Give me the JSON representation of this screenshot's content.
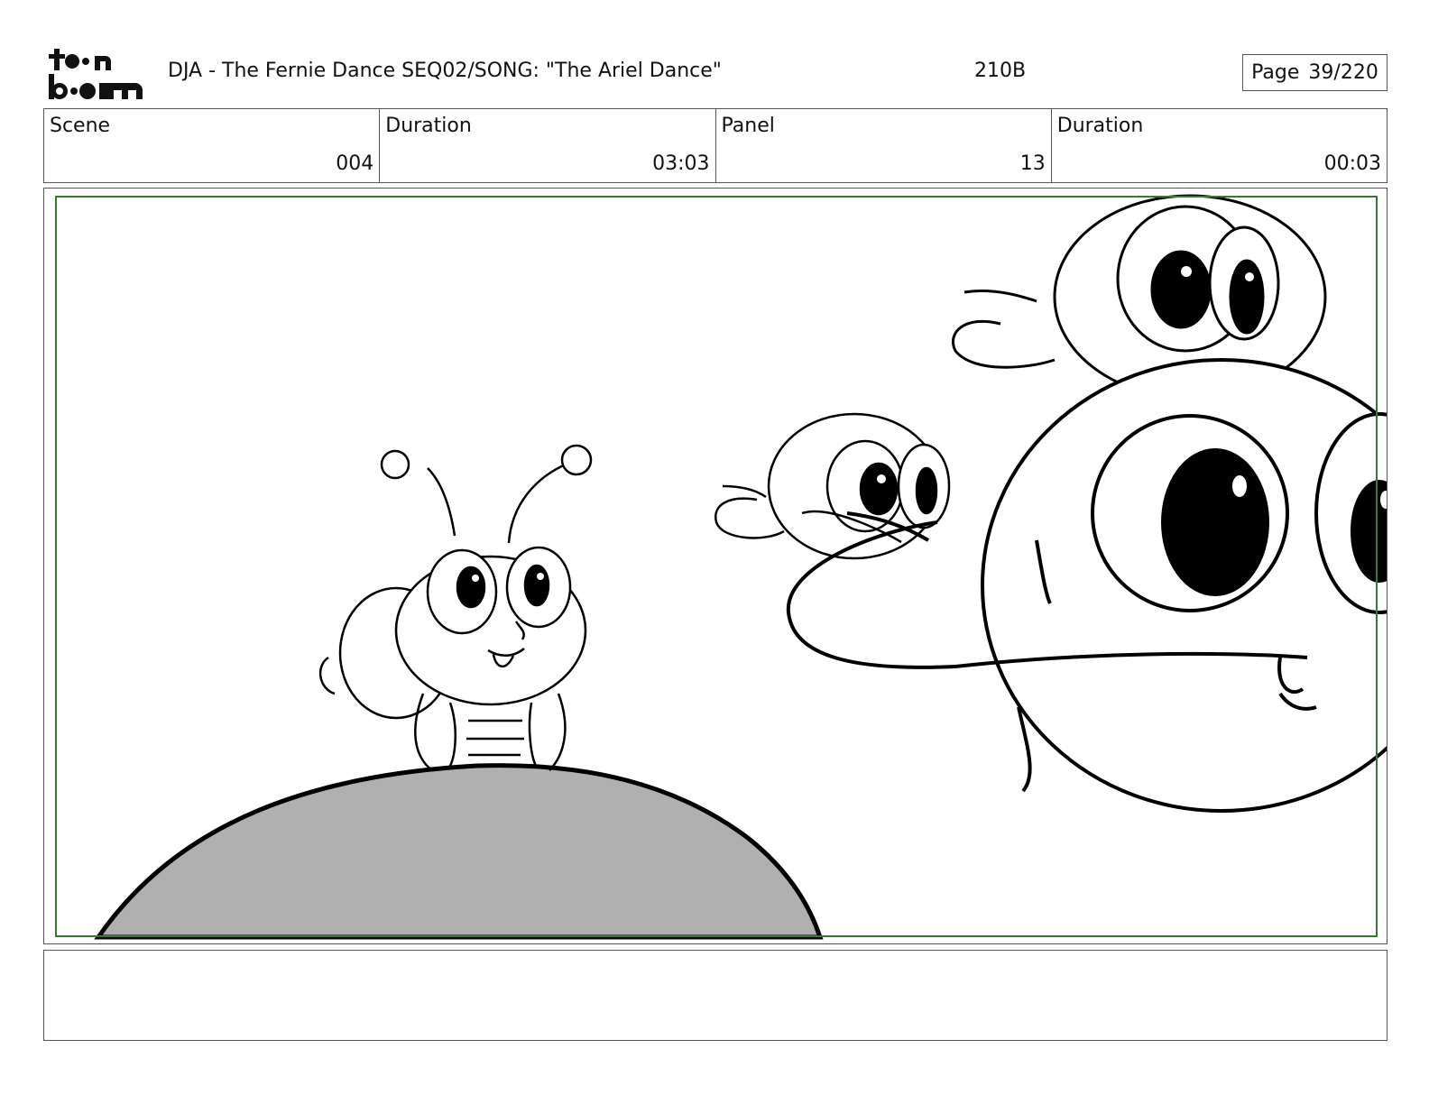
{
  "header": {
    "logo_text": "toon boom",
    "title": "DJA - The Fernie Dance  SEQ02/SONG: \"The Ariel Dance\"",
    "code": "210B",
    "page_label": "Page",
    "page_value": "39/220"
  },
  "info": {
    "scene_label": "Scene",
    "scene_value": "004",
    "duration_label": "Duration",
    "duration_value": "03:03",
    "panel_label": "Panel",
    "panel_value": "13",
    "panel_duration_label": "Duration",
    "panel_duration_value": "00:03"
  },
  "artwork": {
    "icons": [
      "bug-character",
      "frog-character-small",
      "frog-character-large",
      "frog-character-foreground",
      "hill"
    ],
    "colors": {
      "frame": "#2f7d2f",
      "hill": "#b0b0b0",
      "line": "#000000"
    }
  },
  "notes": {
    "text": ""
  }
}
